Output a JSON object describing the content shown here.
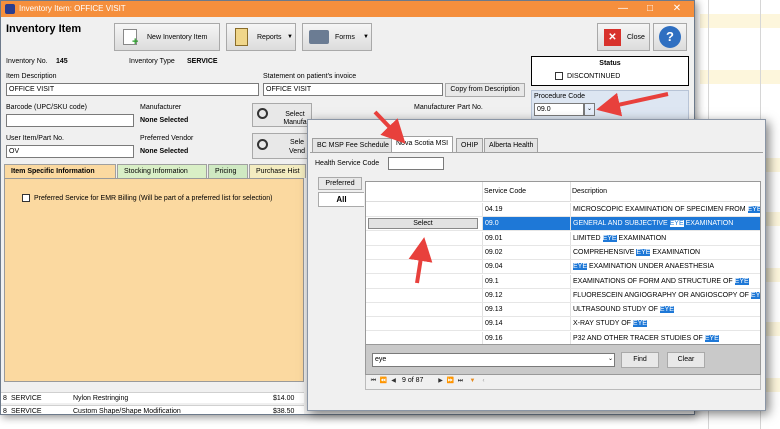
{
  "window": {
    "title": "Inventory Item: OFFICE VISIT",
    "heading": "Inventory Item"
  },
  "toolbar": {
    "new_item": "New Inventory Item",
    "reports": "Reports",
    "forms": "Forms",
    "close": "Close"
  },
  "item": {
    "inventory_no_label": "Inventory No.",
    "inventory_no": "145",
    "inventory_type_label": "Inventory Type",
    "inventory_type": "SERVICE",
    "description_label": "Item Description",
    "description": "OFFICE VISIT",
    "statement_label": "Statement on patient's invoice",
    "statement": "OFFICE VISIT",
    "copy_from_desc": "Copy from Description",
    "barcode_label": "Barcode (UPC/SKU code)",
    "barcode": "",
    "manufacturer_label": "Manufacturer",
    "manufacturer": "None Selected",
    "select_manufacturer": "Select Manufa",
    "manufacturer_part_label": "Manufacturer Part No.",
    "user_item_label": "User Item/Part No.",
    "user_item": "OV",
    "preferred_vendor_label": "Preferred Vendor",
    "preferred_vendor": "None Selected",
    "select_vendor": "Sele Vend"
  },
  "status": {
    "title": "Status",
    "discontinued": "DISCONTINUED"
  },
  "procedure": {
    "label": "Procedure Code",
    "value": "09.0"
  },
  "main_tabs": [
    "Item Specific Information",
    "Stocking Information",
    "Pricing",
    "Purchase Hist"
  ],
  "preferred_checkbox": "Preferred Service for EMR Billing (Will be part of a preferred list for selection)",
  "lower_rows": [
    {
      "num": "8",
      "type": "SERVICE",
      "desc": "Nylon Restringing",
      "price": "$14.00"
    },
    {
      "num": "8",
      "type": "SERVICE",
      "desc": "Custom Shape/Shape Modification",
      "price": "$38.50"
    }
  ],
  "popup": {
    "tabs": [
      "BC MSP Fee Schedule",
      "Nova Scotia MSI",
      "OHIP",
      "Alberta Health"
    ],
    "active_tab": "Nova Scotia MSI",
    "health_service_code_label": "Health Service Code",
    "health_service_code": "",
    "side_tabs": [
      "Preferred",
      "All"
    ],
    "columns": [
      "Service Code",
      "Description"
    ],
    "select_button": "Select",
    "rows": [
      {
        "code": "04.19",
        "pre": "MICROSCOPIC EXAMINATION OF SPECIMEN FROM ",
        "hl": "EYE",
        "post": ""
      },
      {
        "code": "09.0",
        "pre": "GENERAL AND SUBJECTIVE ",
        "hl": "EYE",
        "post": " EXAMINATION"
      },
      {
        "code": "09.01",
        "pre": "LIMITED ",
        "hl": "EYE",
        "post": " EXAMINATION"
      },
      {
        "code": "09.02",
        "pre": "COMPREHENSIVE ",
        "hl": "EYE",
        "post": " EXAMINATION"
      },
      {
        "code": "09.04",
        "pre": "",
        "hl": "EYE",
        "post": " EXAMINATION UNDER ANAESTHESIA"
      },
      {
        "code": "09.1",
        "pre": "EXAMINATIONS OF FORM AND STRUCTURE OF ",
        "hl": "EYE",
        "post": ""
      },
      {
        "code": "09.12",
        "pre": "FLUORESCEIN ANGIOGRAPHY OR ANGIOSCOPY OF ",
        "hl": "EYE",
        "post": ""
      },
      {
        "code": "09.13",
        "pre": "ULTRASOUND STUDY OF ",
        "hl": "EYE",
        "post": ""
      },
      {
        "code": "09.14",
        "pre": "X-RAY STUDY OF ",
        "hl": "EYE",
        "post": ""
      },
      {
        "code": "09.16",
        "pre": "P32 AND OTHER TRACER STUDIES OF ",
        "hl": "EYE",
        "post": ""
      }
    ],
    "search_value": "eye",
    "find": "Find",
    "clear": "Clear",
    "pager": "9 of 87"
  },
  "colors": {
    "titlebar": "#f58f3d",
    "selection": "#1e78d7",
    "arrow": "#e8403c",
    "tab_panel": "#fbd9a0"
  }
}
